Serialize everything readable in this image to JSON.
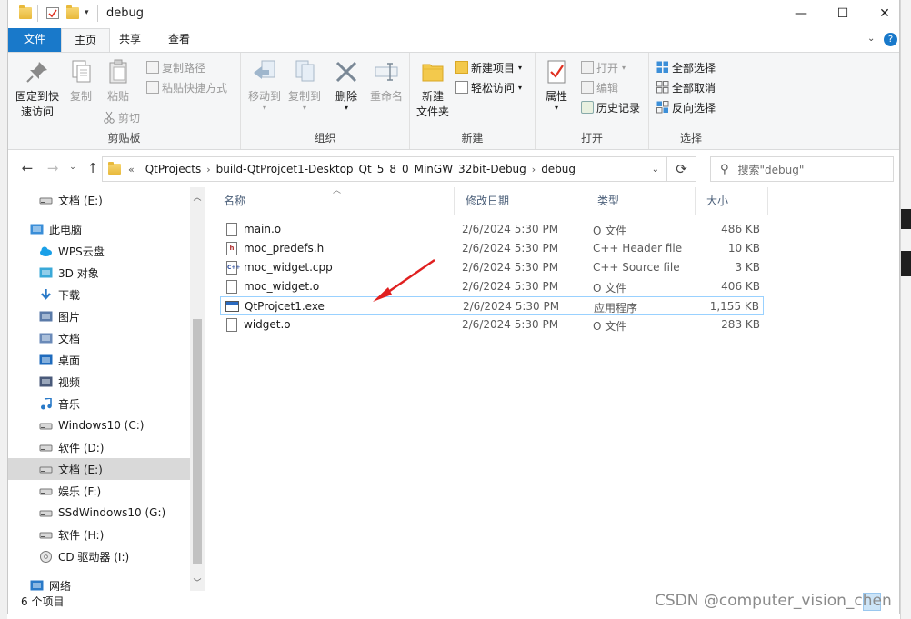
{
  "window": {
    "title": "debug",
    "minimize": "—",
    "maximize": "☐",
    "close": "✕"
  },
  "ribbon_tabs": [
    "文件",
    "主页",
    "共享",
    "查看"
  ],
  "ribbon": {
    "clipboard": {
      "pin": "固定到快速访问",
      "pin_line1": "固定到快",
      "pin_line2": "速访问",
      "copy": "复制",
      "paste": "粘贴",
      "copy_path": "复制路径",
      "paste_shortcut": "粘贴快捷方式",
      "cut": "剪切",
      "label": "剪贴板"
    },
    "organize": {
      "move_to": "移动到",
      "copy_to": "复制到",
      "delete": "删除",
      "rename": "重命名",
      "label": "组织"
    },
    "new": {
      "new_folder_line1": "新建",
      "new_folder_line2": "文件夹",
      "new_item": "新建项目",
      "easy_access": "轻松访问",
      "label": "新建"
    },
    "open": {
      "properties": "属性",
      "open": "打开",
      "edit": "编辑",
      "history": "历史记录",
      "label": "打开"
    },
    "select": {
      "select_all": "全部选择",
      "select_none": "全部取消",
      "invert": "反向选择",
      "label": "选择"
    }
  },
  "address": {
    "prefix": "«",
    "crumbs": [
      "QtProjects",
      "build-QtProjcet1-Desktop_Qt_5_8_0_MinGW_32bit-Debug",
      "debug"
    ],
    "search_placeholder": "搜索\"debug\""
  },
  "nav_pane": [
    {
      "label": "文档 (E:)",
      "icon": "drive-icon",
      "selected": false
    },
    {
      "label": "此电脑",
      "icon": "computer-icon",
      "selected": false
    },
    {
      "label": "WPS云盘",
      "icon": "cloud-icon",
      "selected": false
    },
    {
      "label": "3D 对象",
      "icon": "cube-icon",
      "selected": false
    },
    {
      "label": "下载",
      "icon": "download-icon",
      "selected": false
    },
    {
      "label": "图片",
      "icon": "pictures-icon",
      "selected": false
    },
    {
      "label": "文档",
      "icon": "documents-icon",
      "selected": false
    },
    {
      "label": "桌面",
      "icon": "desktop-icon",
      "selected": false
    },
    {
      "label": "视频",
      "icon": "video-icon",
      "selected": false
    },
    {
      "label": "音乐",
      "icon": "music-icon",
      "selected": false
    },
    {
      "label": "Windows10 (C:)",
      "icon": "drive-icon",
      "selected": false
    },
    {
      "label": "软件 (D:)",
      "icon": "drive-icon",
      "selected": false
    },
    {
      "label": "文档 (E:)",
      "icon": "drive-icon",
      "selected": true
    },
    {
      "label": "娱乐 (F:)",
      "icon": "drive-icon",
      "selected": false
    },
    {
      "label": "SSdWindows10 (G:)",
      "icon": "ssd-icon",
      "selected": false
    },
    {
      "label": "软件 (H:)",
      "icon": "drive-icon",
      "selected": false
    },
    {
      "label": "CD 驱动器 (I:)",
      "icon": "cd-icon",
      "selected": false
    },
    {
      "label": "网络",
      "icon": "network-icon",
      "selected": false
    }
  ],
  "columns": {
    "name": "名称",
    "date": "修改日期",
    "type": "类型",
    "size": "大小"
  },
  "files": [
    {
      "name": "main.o",
      "date": "2/6/2024 5:30 PM",
      "type": "O 文件",
      "size": "486 KB",
      "icon": "file-icon"
    },
    {
      "name": "moc_predefs.h",
      "date": "2/6/2024 5:30 PM",
      "type": "C++ Header file",
      "size": "10 KB",
      "icon": "header-file-icon"
    },
    {
      "name": "moc_widget.cpp",
      "date": "2/6/2024 5:30 PM",
      "type": "C++ Source file",
      "size": "3 KB",
      "icon": "source-file-icon"
    },
    {
      "name": "moc_widget.o",
      "date": "2/6/2024 5:30 PM",
      "type": "O 文件",
      "size": "406 KB",
      "icon": "file-icon"
    },
    {
      "name": "QtProjcet1.exe",
      "date": "2/6/2024 5:30 PM",
      "type": "应用程序",
      "size": "1,155 KB",
      "icon": "exe-icon",
      "selected": true
    },
    {
      "name": "widget.o",
      "date": "2/6/2024 5:30 PM",
      "type": "O 文件",
      "size": "283 KB",
      "icon": "file-icon"
    }
  ],
  "status": {
    "count": "6 个项目"
  },
  "watermark": "CSDN @computer_vision_chen",
  "colors": {
    "file_tab": "#1979ca",
    "selection_border": "#99d1ff",
    "arrow": "#e02020"
  }
}
